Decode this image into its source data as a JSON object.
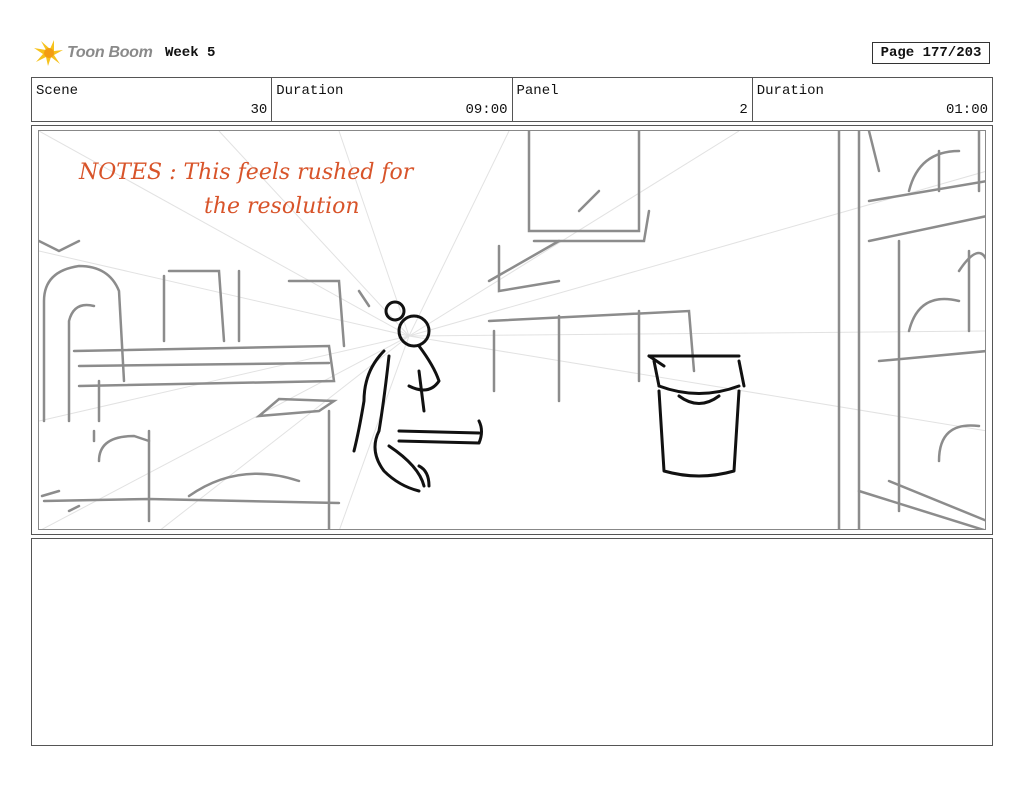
{
  "header": {
    "logo_text": "Toon Boom",
    "doc_title": "Week 5",
    "page_label": "Page 177/203"
  },
  "info": [
    {
      "label": "Scene",
      "value": "30"
    },
    {
      "label": "Duration",
      "value": "09:00"
    },
    {
      "label": "Panel",
      "value": "2"
    },
    {
      "label": "Duration",
      "value": "01:00"
    }
  ],
  "panel": {
    "notes_line1": "NOTES :  This feels rushed for",
    "notes_line2": "the resolution",
    "notes_color": "#d8542a"
  },
  "action_notes": ""
}
